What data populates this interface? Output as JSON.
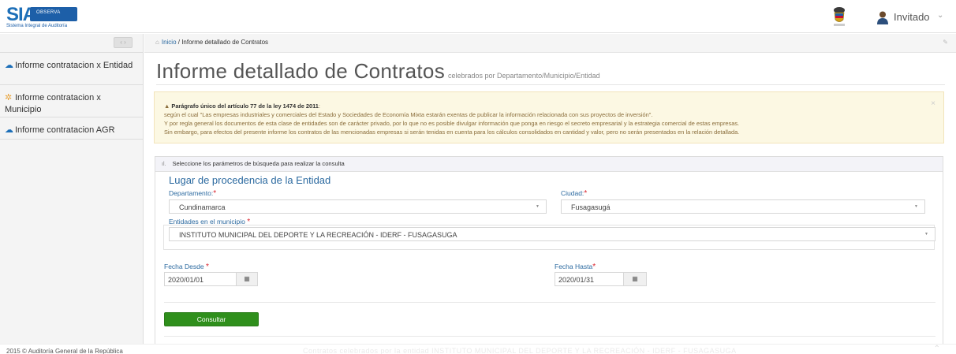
{
  "logo": {
    "brand": "SIA",
    "badge": "OBSERVA",
    "subtitle": "Sistema Integral de Auditoría"
  },
  "user": {
    "name": "Invitado",
    "caret": "⌄"
  },
  "sidebar": {
    "toggle": "‹ ›",
    "items": [
      {
        "label": "Informe contratacion x Entidad"
      },
      {
        "label": "Informe contratacion x Municipio"
      },
      {
        "label": "Informe contratacion AGR"
      }
    ]
  },
  "breadcrumb": {
    "home": "Inicio",
    "separator": " / ",
    "current": "Informe detallado de Contratos"
  },
  "page": {
    "title": "Informe detallado de Contratos",
    "subtitle": "celebrados por Departamento/Municipio/Entidad"
  },
  "alert": {
    "title": "Parágrafo único del artículo 77 de la ley 1474 de 2011",
    "title_suffix": ":",
    "lines": [
      "según el cual \"Las empresas industriales y comerciales del Estado y Sociedades de Economía Mixta estarán exentas de publicar la información relacionada con sus proyectos de inversión\".",
      "Y por regla general los documentos de esta clase de entidades son de carácter privado, por lo que no es posible divulgar información que ponga en riesgo el secreto empresarial y la estrategia comercial de estas empresas.",
      "Sin embargo, para efectos del presente informe los contratos de las mencionadas empresas si serán tenidas en cuenta para los cálculos consolidados en cantidad y valor, pero no serán presentados en la relación detallada."
    ],
    "close": "×"
  },
  "search": {
    "panel_title": "Seleccione los parámetros de búsqueda para realizar la consulta",
    "section_title": "Lugar de procedencia de la Entidad",
    "departamento": {
      "label": "Departamento:",
      "value": "Cundinamarca"
    },
    "ciudad": {
      "label": "Ciudad:",
      "value": "Fusagasugá"
    },
    "entidades": {
      "label": "Entidades en el municipio",
      "value": "INSTITUTO MUNICIPAL DEL DEPORTE Y LA RECREACIÓN - IDERF - FUSAGASUGA"
    },
    "fecha_desde": {
      "label": "Fecha Desde",
      "value": "2020/01/01"
    },
    "fecha_hasta": {
      "label": "Fecha Hasta",
      "value": "2020/01/31"
    },
    "required_mark": "*",
    "submit_label": "Consultar"
  },
  "footer": {
    "copyright": "2015 © Auditoría General de la República",
    "faded_text": "Contratos celebrados por la entidad INSTITUTO MUNICIPAL DEL DEPORTE Y LA RECREACIÓN - IDERF - FUSAGASUGA"
  },
  "colors": {
    "accent": "#2c6aa0",
    "brand": "#1d6fb8",
    "alert_bg": "#fcf8e3",
    "button": "#2f8f1c",
    "required": "#d9232d"
  },
  "icons": {
    "sidebar_entidad": "cloud-icon",
    "sidebar_municipio": "gear-icon",
    "sidebar_agr": "cloud-icon",
    "calendar": "calendar-icon",
    "home": "home-icon",
    "chart": "bar-chart-icon"
  }
}
